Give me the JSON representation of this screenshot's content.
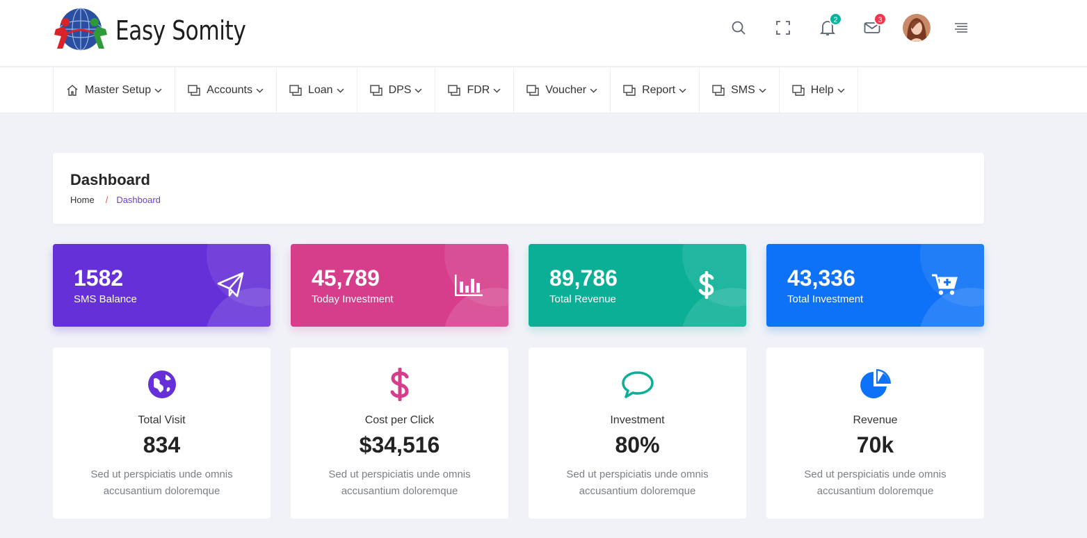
{
  "brand": {
    "name": "Easy Somity"
  },
  "header": {
    "icons": [
      "search-icon",
      "fullscreen-icon",
      "bell-icon",
      "mail-icon",
      "avatar",
      "menu-icon"
    ],
    "notification_count": "2",
    "message_count": "3"
  },
  "nav": {
    "items": [
      {
        "label": "Master Setup",
        "icon": "home-icon"
      },
      {
        "label": "Accounts",
        "icon": "copy-icon"
      },
      {
        "label": "Loan",
        "icon": "copy-icon"
      },
      {
        "label": "DPS",
        "icon": "copy-icon"
      },
      {
        "label": "FDR",
        "icon": "copy-icon"
      },
      {
        "label": "Voucher",
        "icon": "copy-icon"
      },
      {
        "label": "Report",
        "icon": "copy-icon"
      },
      {
        "label": "SMS",
        "icon": "copy-icon"
      },
      {
        "label": "Help",
        "icon": "copy-icon"
      }
    ]
  },
  "page": {
    "title": "Dashboard",
    "breadcrumb": {
      "home": "Home",
      "separator": "/",
      "current": "Dashboard"
    }
  },
  "stats": [
    {
      "value": "1582",
      "label": "SMS Balance",
      "icon": "paper-plane-icon",
      "color": "#6530d8"
    },
    {
      "value": "45,789",
      "label": "Today Investment",
      "icon": "bar-chart-icon",
      "color": "#d63e8c"
    },
    {
      "value": "89,786",
      "label": "Total Revenue",
      "icon": "dollar-icon",
      "color": "#0aaf96"
    },
    {
      "value": "43,336",
      "label": "Total Investment",
      "icon": "cart-plus-icon",
      "color": "#0d72f7"
    }
  ],
  "info_cards": [
    {
      "label": "Total Visit",
      "value": "834",
      "desc": "Sed ut perspiciatis unde omnis accusantium doloremque",
      "icon": "globe-icon",
      "color": "#6530d8"
    },
    {
      "label": "Cost per Click",
      "value": "$34,516",
      "desc": "Sed ut perspiciatis unde omnis accusantium doloremque",
      "icon": "dollar-icon",
      "color": "#d63e8c"
    },
    {
      "label": "Investment",
      "value": "80%",
      "desc": "Sed ut perspiciatis unde omnis accusantium doloremque",
      "icon": "chat-bubble-icon",
      "color": "#0aaf96"
    },
    {
      "label": "Revenue",
      "value": "70k",
      "desc": "Sed ut perspiciatis unde omnis accusantium doloremque",
      "icon": "pie-chart-icon",
      "color": "#0d72f7"
    }
  ]
}
